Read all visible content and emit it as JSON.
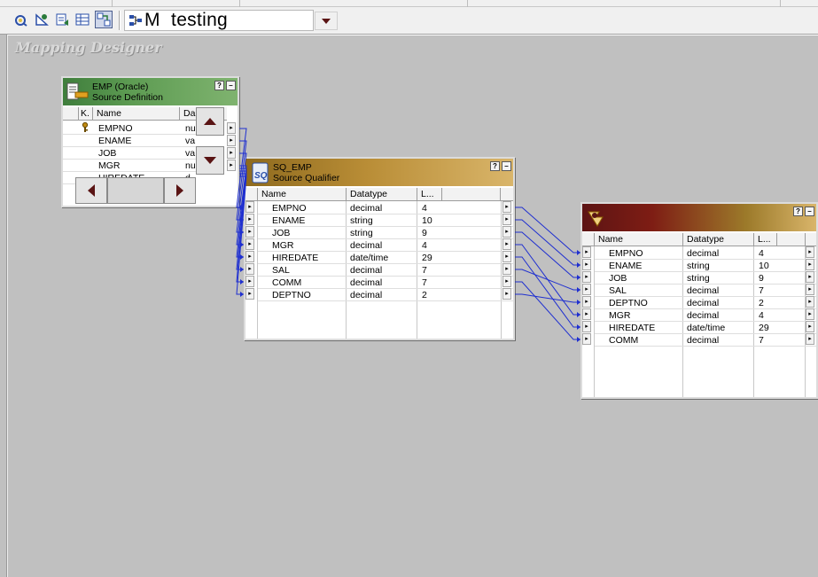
{
  "toolbar": {
    "icons": [
      "source-analyzer-icon",
      "target-designer-icon",
      "transformation-developer-icon",
      "mapplet-designer-icon",
      "mapping-designer-icon"
    ],
    "active_icon": "mapping-designer-icon",
    "mapping_name": "M  testing"
  },
  "workspace": {
    "title": "Mapping Designer"
  },
  "source": {
    "title_line1": "EMP (Oracle)",
    "title_line2": "Source Definition",
    "columns": [
      "K.",
      "Name",
      "Da"
    ],
    "rows": [
      {
        "key": "key-icon",
        "name": "EMPNO",
        "dtype": "nu"
      },
      {
        "key": "",
        "name": "ENAME",
        "dtype": "va"
      },
      {
        "key": "",
        "name": "JOB",
        "dtype": "va"
      },
      {
        "key": "",
        "name": "MGR",
        "dtype": "nu"
      },
      {
        "key": "",
        "name": "HIREDATE",
        "dtype": "d"
      }
    ],
    "help": "?",
    "minimize": "–"
  },
  "qualifier": {
    "title_line1": "SQ_EMP",
    "title_line2": "Source Qualifier",
    "columns": [
      "Name",
      "Datatype",
      "L..."
    ],
    "rows": [
      {
        "name": "EMPNO",
        "dtype": "decimal",
        "len": "4"
      },
      {
        "name": "ENAME",
        "dtype": "string",
        "len": "10"
      },
      {
        "name": "JOB",
        "dtype": "string",
        "len": "9"
      },
      {
        "name": "MGR",
        "dtype": "decimal",
        "len": "4"
      },
      {
        "name": "HIREDATE",
        "dtype": "date/time",
        "len": "29"
      },
      {
        "name": "SAL",
        "dtype": "decimal",
        "len": "7"
      },
      {
        "name": "COMM",
        "dtype": "decimal",
        "len": "7"
      },
      {
        "name": "DEPTNO",
        "dtype": "decimal",
        "len": "2"
      }
    ],
    "help": "?",
    "minimize": "–"
  },
  "target": {
    "title_line1": "",
    "columns": [
      "Name",
      "Datatype",
      "L..."
    ],
    "rows": [
      {
        "name": "EMPNO",
        "dtype": "decimal",
        "len": "4"
      },
      {
        "name": "ENAME",
        "dtype": "string",
        "len": "10"
      },
      {
        "name": "JOB",
        "dtype": "string",
        "len": "9"
      },
      {
        "name": "SAL",
        "dtype": "decimal",
        "len": "7"
      },
      {
        "name": "DEPTNO",
        "dtype": "decimal",
        "len": "2"
      },
      {
        "name": "MGR",
        "dtype": "decimal",
        "len": "4"
      },
      {
        "name": "HIREDATE",
        "dtype": "date/time",
        "len": "29"
      },
      {
        "name": "COMM",
        "dtype": "decimal",
        "len": "7"
      }
    ],
    "help": "?",
    "minimize": "–"
  },
  "links": {
    "color": "#1f2fd0",
    "sq_to_target": [
      [
        0,
        0
      ],
      [
        1,
        1
      ],
      [
        2,
        2
      ],
      [
        3,
        5
      ],
      [
        4,
        6
      ],
      [
        5,
        3
      ],
      [
        6,
        7
      ],
      [
        7,
        4
      ]
    ]
  }
}
